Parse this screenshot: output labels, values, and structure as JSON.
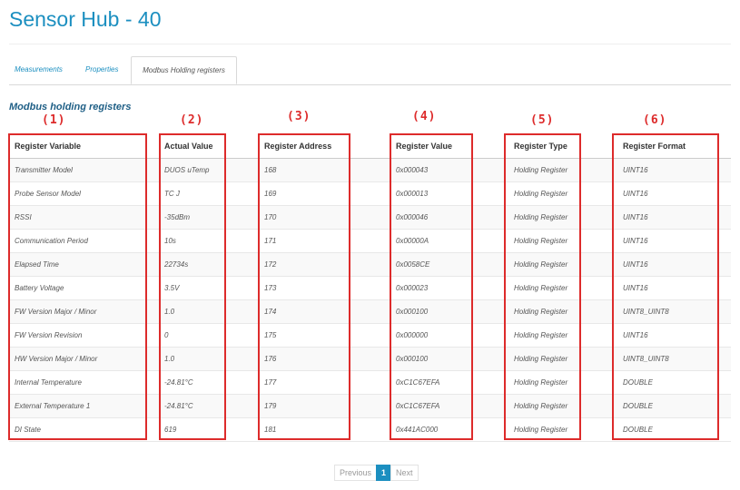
{
  "page": {
    "title": "Sensor Hub - 40"
  },
  "tabs": [
    {
      "label": "Measurements"
    },
    {
      "label": "Properties"
    },
    {
      "label": "Modbus Holding registers"
    }
  ],
  "section": {
    "title": "Modbus holding registers"
  },
  "annotations": [
    "(1)",
    "(2)",
    "(3)",
    "(4)",
    "(5)",
    "(6)"
  ],
  "table": {
    "headers": [
      "Register Variable",
      "Actual Value",
      "Register Address",
      "Register Value",
      "Register Type",
      "Register Format"
    ],
    "rows": [
      [
        "Transmitter Model",
        "DUOS uTemp",
        "168",
        "0x000043",
        "Holding Register",
        "UINT16"
      ],
      [
        "Probe Sensor Model",
        "TC J",
        "169",
        "0x000013",
        "Holding Register",
        "UINT16"
      ],
      [
        "RSSI",
        "-35dBm",
        "170",
        "0x000046",
        "Holding Register",
        "UINT16"
      ],
      [
        "Communication Period",
        "10s",
        "171",
        "0x00000A",
        "Holding Register",
        "UINT16"
      ],
      [
        "Elapsed Time",
        "22734s",
        "172",
        "0x0058CE",
        "Holding Register",
        "UINT16"
      ],
      [
        "Battery Voltage",
        "3.5V",
        "173",
        "0x000023",
        "Holding Register",
        "UINT16"
      ],
      [
        "FW Version Major / Minor",
        "1.0",
        "174",
        "0x000100",
        "Holding Register",
        "UINT8_UINT8"
      ],
      [
        "FW Version Revision",
        "0",
        "175",
        "0x000000",
        "Holding Register",
        "UINT16"
      ],
      [
        "HW Version Major / Minor",
        "1.0",
        "176",
        "0x000100",
        "Holding Register",
        "UINT8_UINT8"
      ],
      [
        "Internal Temperature",
        "-24.81°C",
        "177",
        "0xC1C67EFA",
        "Holding Register",
        "DOUBLE"
      ],
      [
        "External Temperature 1",
        "-24.81°C",
        "179",
        "0xC1C67EFA",
        "Holding Register",
        "DOUBLE"
      ],
      [
        "DI State",
        "619",
        "181",
        "0x441AC000",
        "Holding Register",
        "DOUBLE"
      ]
    ]
  },
  "pagination": {
    "previous": "Previous",
    "current": "1",
    "next": "Next"
  },
  "colors": {
    "accent": "#1c8fc0",
    "highlight": "#dd2b2b",
    "section": "#1f5f86"
  }
}
